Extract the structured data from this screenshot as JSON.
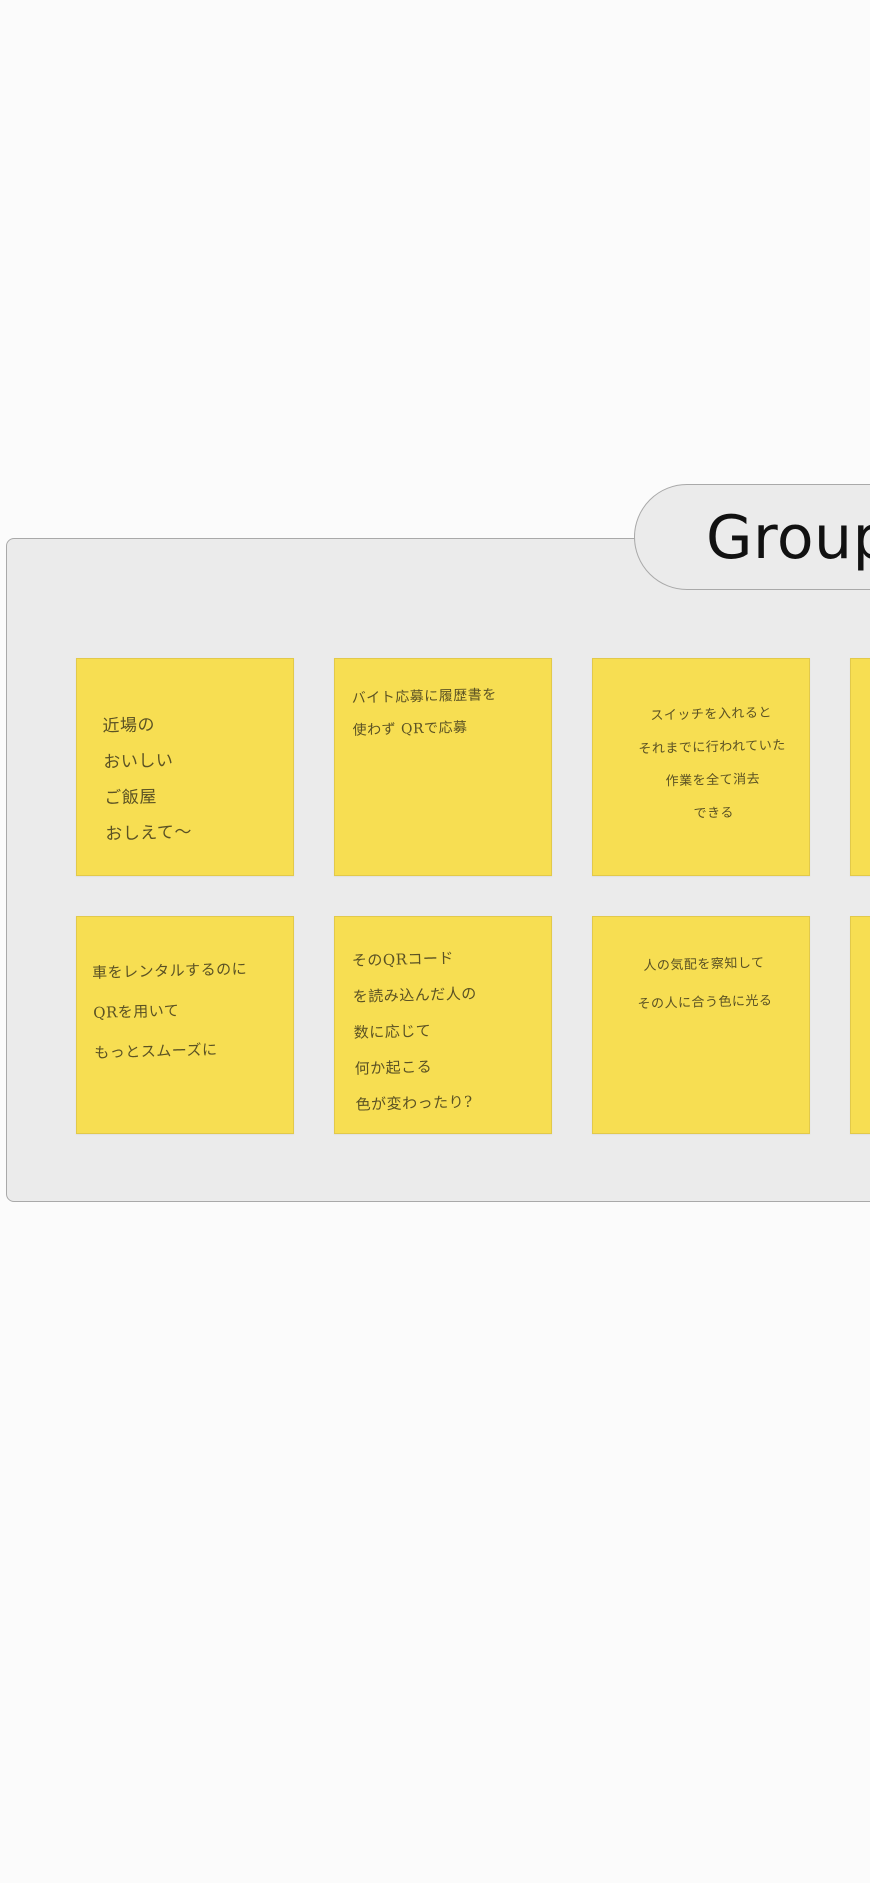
{
  "board": {
    "group_title": "Group"
  },
  "notes": [
    {
      "text": "近場の\nおいしい\nご飯屋\nおしえて〜"
    },
    {
      "text": "バイト応募に履歴書を\n使わず QRで応募"
    },
    {
      "text": "スイッチを入れると\nそれまでに行われていた\n作業を全て消去\nできる"
    },
    {
      "text": "車をレンタルするのに\nQRを用いて\nもっとスムーズに"
    },
    {
      "text": "そのQRコード\nを読み込んだ人の\n数に応じて\n何か起こる\n色が変わったり?"
    },
    {
      "text": "人の気配を察知して\nその人に合う色に光る"
    }
  ],
  "colors": {
    "sticky": "#f7de52",
    "frame_bg": "#ebebeb",
    "frame_border": "#a9a9a9",
    "canvas_bg": "#fbfbfb"
  }
}
